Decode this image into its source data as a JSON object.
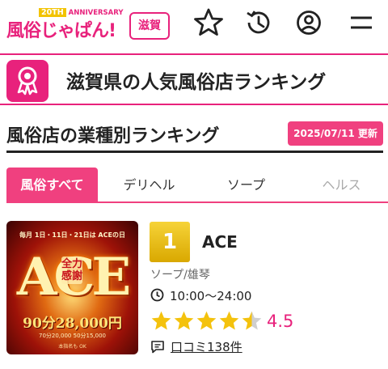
{
  "header": {
    "logo_text": "風俗じゃぱん!",
    "logo_anniversary_badge": "20TH",
    "logo_anniversary_text": "ANNIVERSARY",
    "region_button": "滋賀",
    "icons": [
      "star-icon",
      "history-icon",
      "account-icon",
      "menu-icon"
    ]
  },
  "page_title": "滋賀県の人気風俗店ランキング",
  "section": {
    "title": "風俗店の業種別ランキング",
    "date_badge": "2025/07/11 更新"
  },
  "tabs": [
    {
      "label": "風俗すべて",
      "active": true
    },
    {
      "label": "デリヘル",
      "active": false
    },
    {
      "label": "ソープ",
      "active": false
    },
    {
      "label": "ヘルス",
      "active": false
    }
  ],
  "ranking": [
    {
      "rank": "1",
      "name": "ACE",
      "category": "ソープ/雄琴",
      "hours": "10:00〜24:00",
      "rating": "4.5",
      "rating_value": 4.5,
      "reviews": "口コミ138件",
      "image": {
        "top_text": "毎月 1日・11日・21日は ACEの日",
        "logo": "ACE",
        "vertical_text": "全力感謝",
        "price": "90分28,000円",
        "sub_text": "70分20,000 50分15,000",
        "foot_text": "本指名も OK"
      }
    }
  ],
  "colors": {
    "accent": "#e8227c",
    "tab_active": "#f0407f",
    "rank_gold": "#f2c300",
    "star": "#f4c20d"
  }
}
